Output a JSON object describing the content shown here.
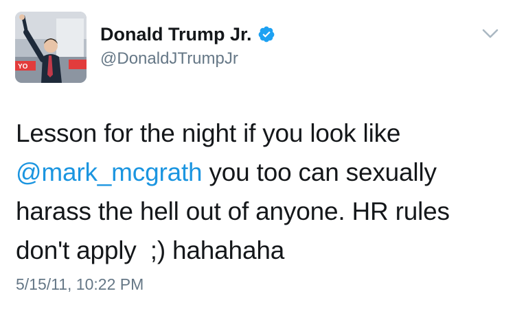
{
  "author": {
    "display_name": "Donald Trump Jr.",
    "handle": "@DonaldJTrumpJr",
    "verified": true,
    "avatar_icon": "profile-photo"
  },
  "tweet": {
    "text_before": "Lesson for the night if you look like\n",
    "mention": "@mark_mcgrath",
    "text_after": " you too can sexually harass the hell out of anyone. HR rules don't apply  ;) hahahaha",
    "timestamp": "5/15/11, 10:22 PM"
  },
  "colors": {
    "mention": "#1b95e0",
    "verified_badge": "#1da1f2",
    "secondary_text": "#657786",
    "primary_text": "#14171a"
  },
  "icons": {
    "verified": "verified-badge-icon",
    "menu": "chevron-down-icon"
  }
}
